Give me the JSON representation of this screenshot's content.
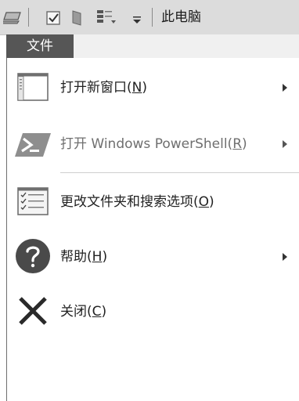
{
  "window": {
    "title": "此电脑"
  },
  "quick_access_toolbar": {
    "icons": [
      "computer-icon",
      "properties-check-icon",
      "new-folder-icon",
      "layout-icon",
      "customize-dropdown-icon"
    ]
  },
  "ribbon": {
    "file_tab_label": "文件"
  },
  "file_menu": {
    "items": [
      {
        "label_prefix": "打开新窗口(",
        "mnemonic": "N",
        "label_suffix": ")",
        "icon": "new-window-icon",
        "has_submenu": true,
        "enabled": true
      },
      {
        "label_prefix": "打开 Windows PowerShell(",
        "mnemonic": "R",
        "label_suffix": ")",
        "icon": "powershell-icon",
        "has_submenu": true,
        "enabled": false
      },
      {
        "label_prefix": "更改文件夹和搜索选项(",
        "mnemonic": "O",
        "label_suffix": ")",
        "icon": "folder-options-icon",
        "has_submenu": false,
        "enabled": true
      },
      {
        "label_prefix": "帮助(",
        "mnemonic": "H",
        "label_suffix": ")",
        "icon": "help-icon",
        "has_submenu": true,
        "enabled": true
      },
      {
        "label_prefix": "关闭(",
        "mnemonic": "C",
        "label_suffix": ")",
        "icon": "close-icon",
        "has_submenu": false,
        "enabled": true
      }
    ]
  }
}
